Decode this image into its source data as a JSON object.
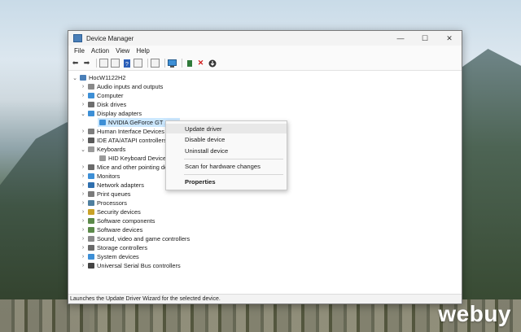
{
  "window": {
    "title": "Device Manager",
    "minimize": "—",
    "maximize": "☐",
    "close": "✕"
  },
  "menu": [
    "File",
    "Action",
    "View",
    "Help"
  ],
  "toolbar_icons": [
    "back-arrow-icon",
    "forward-arrow-icon",
    "properties-icon",
    "show-hidden-icon",
    "help-icon",
    "view-icon",
    "update-driver-icon",
    "scan-hardware-icon",
    "add-legacy-icon",
    "uninstall-icon",
    "download-icon"
  ],
  "tree": {
    "root": "HocW1122H2",
    "items": [
      {
        "label": "Audio inputs and outputs",
        "expander": "›"
      },
      {
        "label": "Computer",
        "expander": "›"
      },
      {
        "label": "Disk drives",
        "expander": "›"
      },
      {
        "label": "Display adapters",
        "expander": "⌄"
      },
      {
        "label": "NVIDIA GeForce GT 1030",
        "expander": "",
        "child": true,
        "selected": true
      },
      {
        "label": "Human Interface Devices",
        "expander": "›"
      },
      {
        "label": "IDE ATA/ATAPI controllers",
        "expander": "›"
      },
      {
        "label": "Keyboards",
        "expander": "⌄"
      },
      {
        "label": "HID Keyboard Device",
        "expander": "",
        "child": true
      },
      {
        "label": "Mice and other pointing devices",
        "expander": "›"
      },
      {
        "label": "Monitors",
        "expander": "›"
      },
      {
        "label": "Network adapters",
        "expander": "›"
      },
      {
        "label": "Print queues",
        "expander": "›"
      },
      {
        "label": "Processors",
        "expander": "›"
      },
      {
        "label": "Security devices",
        "expander": "›"
      },
      {
        "label": "Software components",
        "expander": "›"
      },
      {
        "label": "Software devices",
        "expander": "›"
      },
      {
        "label": "Sound, video and game controllers",
        "expander": "›"
      },
      {
        "label": "Storage controllers",
        "expander": "›"
      },
      {
        "label": "System devices",
        "expander": "›"
      },
      {
        "label": "Universal Serial Bus controllers",
        "expander": "›"
      }
    ]
  },
  "context_menu": {
    "update_driver": "Update driver",
    "disable_device": "Disable device",
    "uninstall_device": "Uninstall device",
    "scan": "Scan for hardware changes",
    "properties": "Properties"
  },
  "status": "Launches the Update Driver Wizard for the selected device.",
  "watermark": "webuy",
  "colors": {
    "selection": "#cce8ff",
    "accent": "#0067c0"
  }
}
